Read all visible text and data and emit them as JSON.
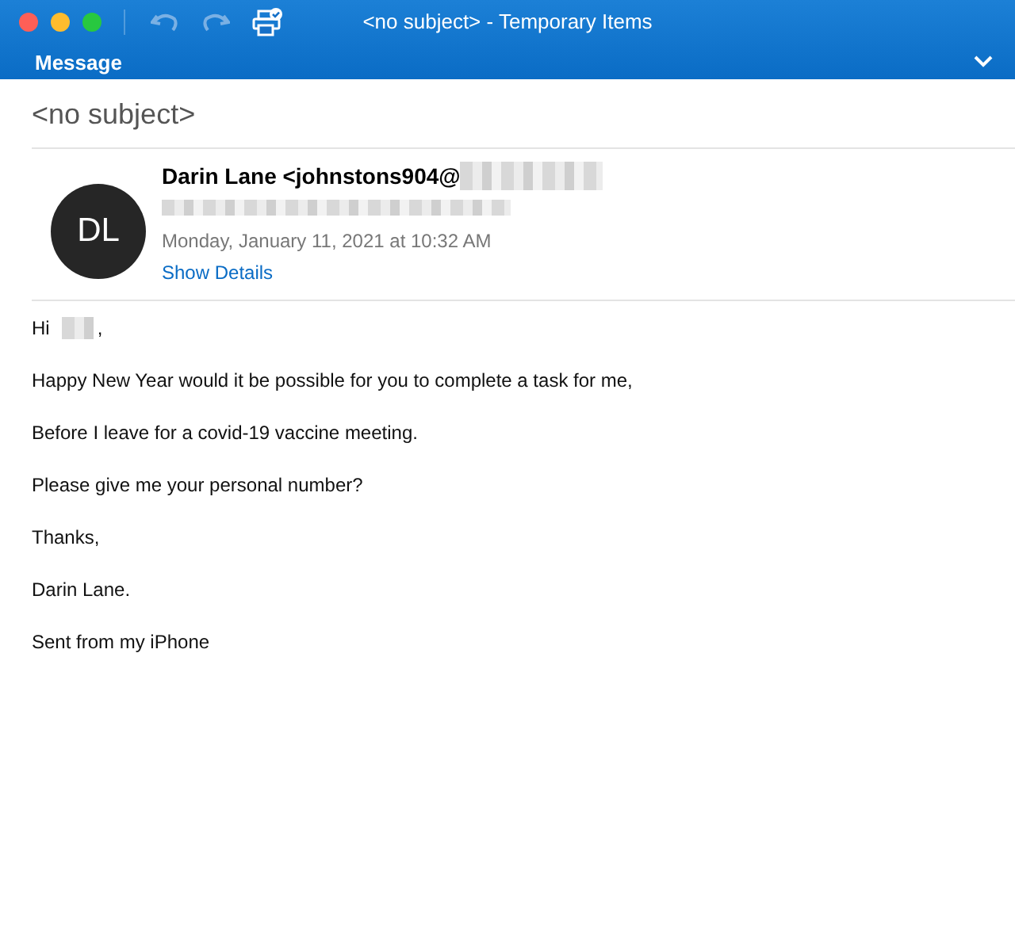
{
  "window": {
    "title": "<no subject> - Temporary Items"
  },
  "ribbon": {
    "tab": "Message"
  },
  "message": {
    "subject": "<no subject>",
    "avatar_initials": "DL",
    "sender": "Darin Lane <johnstons904@",
    "date": "Monday, January 11, 2021 at 10:32 AM",
    "details_link": "Show Details"
  },
  "body": [
    {
      "kind": "greeting",
      "before": "Hi",
      "after": ","
    },
    {
      "kind": "text",
      "text": "Happy New Year would it be possible for you to complete a task for me,"
    },
    {
      "kind": "text",
      "text": "Before I leave for a covid-19 vaccine meeting."
    },
    {
      "kind": "text",
      "text": "Please give me your personal number?"
    },
    {
      "kind": "text",
      "text": "Thanks,"
    },
    {
      "kind": "text",
      "text": "Darin Lane."
    },
    {
      "kind": "text",
      "text": "Sent from my iPhone"
    }
  ]
}
